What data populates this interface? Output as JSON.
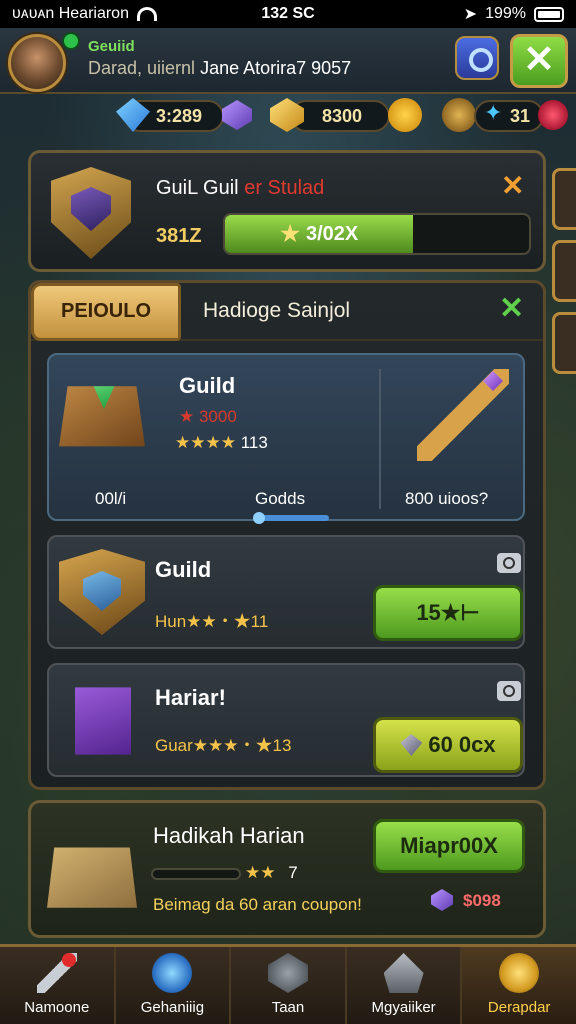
{
  "status_bar": {
    "carrier": "ᴜᴀᴜᴀn Heariaron",
    "time": "132 SC",
    "battery": "199%"
  },
  "header": {
    "rank": "Geuiid",
    "name_prefix": "Darad, uiiernl",
    "name": "Jane Atorira7 9057",
    "close_label": "✕"
  },
  "resources": [
    {
      "icon": "blue-gem-icon",
      "value": "3:289"
    },
    {
      "icon": "purple-gem-icon",
      "value": ""
    },
    {
      "icon": "gold-gem-icon",
      "value": "8300"
    },
    {
      "icon": "lightning-icon",
      "value": ""
    },
    {
      "icon": "medal-icon",
      "value": ""
    },
    {
      "icon": "blue-star-icon",
      "value": "31"
    }
  ],
  "guild": {
    "title": "GuiL Guil",
    "title_red": "er Stulad",
    "level": "381Z",
    "xp_text": "3/02X",
    "xp_fraction": 0.62
  },
  "list": {
    "tab_label": "PEIOULO",
    "title": "Hadioge Sainjol",
    "featured": {
      "name": "Guild",
      "price_red": "3000",
      "stars": "★★★★",
      "rating": "113",
      "left_label": "00l/i",
      "center_label": "Godds",
      "right_label": "800 uioos?"
    },
    "items": [
      {
        "name": "Guild",
        "sub": "Hun★★・★11",
        "button": "15★⊢"
      },
      {
        "name": "Hariar!",
        "sub": "Guar★★★・★13",
        "button": "60 0cx"
      }
    ]
  },
  "quest": {
    "title": "Hadikah Harian",
    "stars": "★★",
    "count": "7",
    "desc": "Beimag da 60 aran coupon!",
    "button": "Miapr00X",
    "reward": "$098",
    "progress_fraction": 0.0
  },
  "nav": [
    {
      "label": "Namoone",
      "icon": "sword-icon"
    },
    {
      "label": "Gehaniiig",
      "icon": "orb-icon"
    },
    {
      "label": "Taan",
      "icon": "rune-icon"
    },
    {
      "label": "Mgyaiiker",
      "icon": "helmet-icon"
    },
    {
      "label": "Derapdar",
      "icon": "sun-emblem-icon"
    }
  ]
}
